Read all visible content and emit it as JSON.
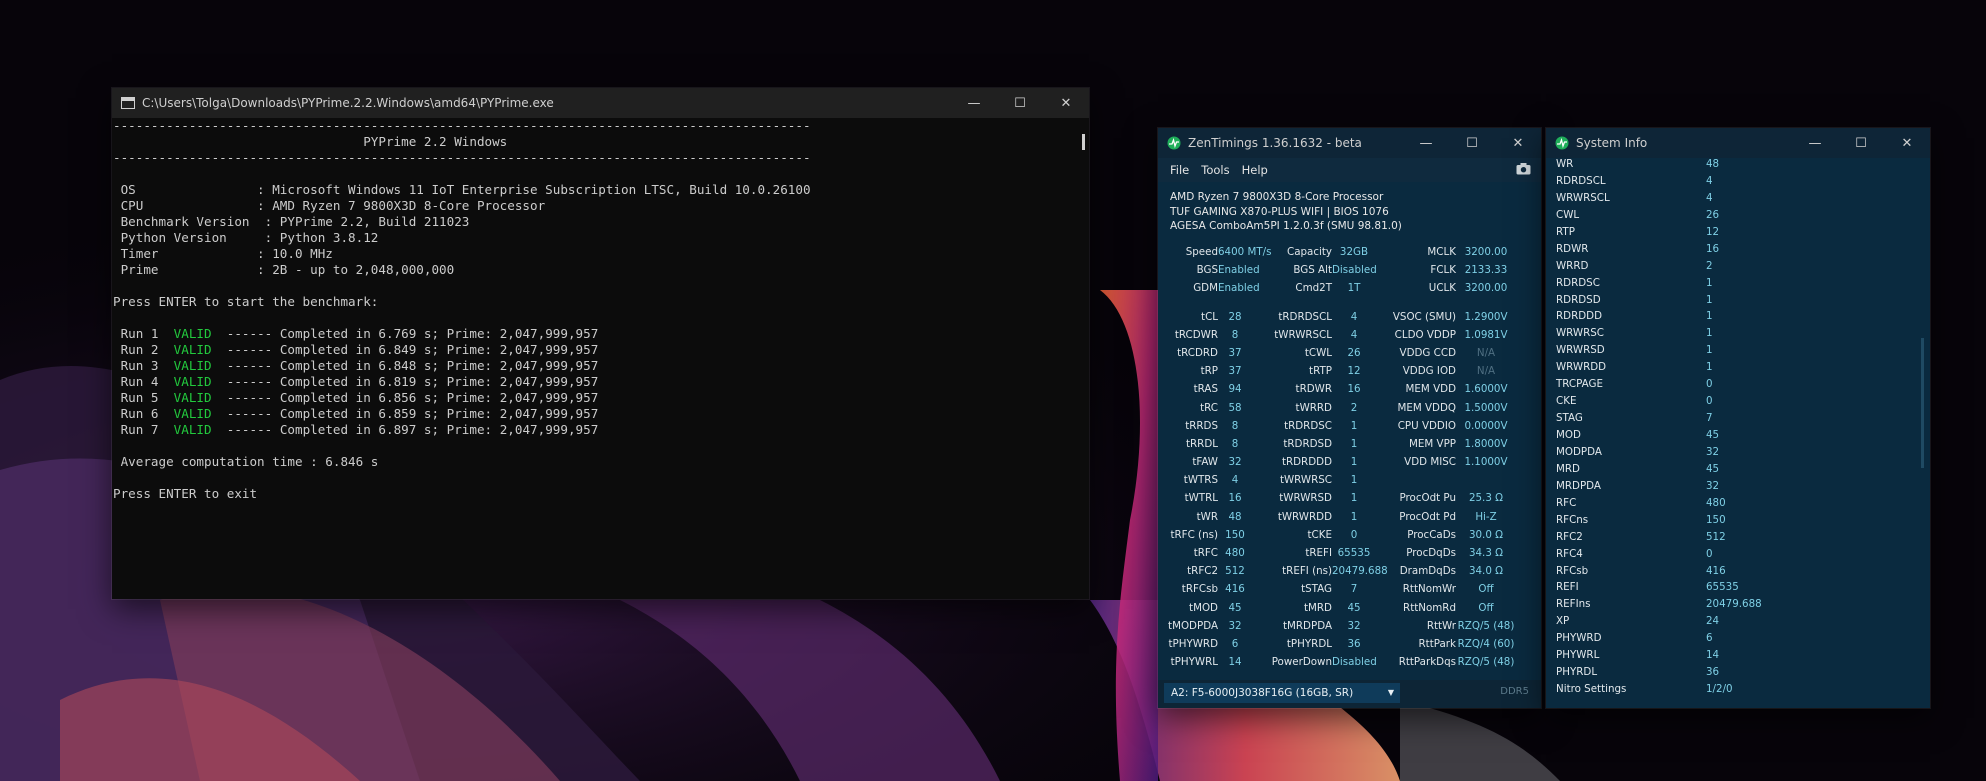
{
  "console": {
    "title": "C:\\Users\\Tolga\\Downloads\\PYPrime.2.2.Windows\\amd64\\PYPrime.exe",
    "lines": [
      {
        "text": "--------------------------------------------------------------------------------------------"
      },
      {
        "text": "                                 PYPrime 2.2 Windows"
      },
      {
        "text": "--------------------------------------------------------------------------------------------"
      },
      {
        "text": ""
      },
      {
        "text": " OS                : Microsoft Windows 11 IoT Enterprise Subscription LTSC, Build 10.0.26100"
      },
      {
        "text": " CPU               : AMD Ryzen 7 9800X3D 8-Core Processor"
      },
      {
        "text": " Benchmark Version  : PYPrime 2.2, Build 211023"
      },
      {
        "text": " Python Version     : Python 3.8.12"
      },
      {
        "text": " Timer             : 10.0 MHz"
      },
      {
        "text": " Prime             : 2B - up to 2,048,000,000"
      },
      {
        "text": ""
      },
      {
        "text": "Press ENTER to start the benchmark:"
      },
      {
        "text": ""
      }
    ],
    "runs": [
      {
        "label": " Run 1  ",
        "status": "VALID",
        "rest": "  ------ Completed in 6.769 s; Prime: 2,047,999,957"
      },
      {
        "label": " Run 2  ",
        "status": "VALID",
        "rest": "  ------ Completed in 6.849 s; Prime: 2,047,999,957"
      },
      {
        "label": " Run 3  ",
        "status": "VALID",
        "rest": "  ------ Completed in 6.848 s; Prime: 2,047,999,957"
      },
      {
        "label": " Run 4  ",
        "status": "VALID",
        "rest": "  ------ Completed in 6.819 s; Prime: 2,047,999,957"
      },
      {
        "label": " Run 5  ",
        "status": "VALID",
        "rest": "  ------ Completed in 6.856 s; Prime: 2,047,999,957"
      },
      {
        "label": " Run 6  ",
        "status": "VALID",
        "rest": "  ------ Completed in 6.859 s; Prime: 2,047,999,957"
      },
      {
        "label": " Run 7  ",
        "status": "VALID",
        "rest": "  ------ Completed in 6.897 s; Prime: 2,047,999,957"
      }
    ],
    "tail_lines": [
      {
        "text": ""
      },
      {
        "text": " Average computation time : 6.846 s"
      },
      {
        "text": ""
      },
      {
        "text": "Press ENTER to exit"
      }
    ]
  },
  "zen": {
    "title": "ZenTimings 1.36.1632 - beta",
    "menu": [
      "File",
      "Tools",
      "Help"
    ],
    "info": [
      "AMD Ryzen 7 9800X3D 8-Core Processor",
      "TUF GAMING X870-PLUS WIFI | BIOS 1076",
      "AGESA ComboAm5PI 1.2.0.3f (SMU 98.81.0)"
    ],
    "top_rows": [
      [
        [
          "Speed",
          "6400 MT/s"
        ],
        [
          "Capacity",
          "32GB"
        ],
        [
          "MCLK",
          "3200.00"
        ]
      ],
      [
        [
          "BGS",
          "Enabled"
        ],
        [
          "BGS Alt",
          "Disabled"
        ],
        [
          "FCLK",
          "2133.33"
        ]
      ],
      [
        [
          "GDM",
          "Enabled"
        ],
        [
          "Cmd2T",
          "1T"
        ],
        [
          "UCLK",
          "3200.00"
        ]
      ]
    ],
    "rows": [
      [
        [
          "tCL",
          "28"
        ],
        [
          "tRDRDSCL",
          "4"
        ],
        [
          "VSOC (SMU)",
          "1.2900V"
        ]
      ],
      [
        [
          "tRCDWR",
          "8"
        ],
        [
          "tWRWRSCL",
          "4"
        ],
        [
          "CLDO VDDP",
          "1.0981V"
        ]
      ],
      [
        [
          "tRCDRD",
          "37"
        ],
        [
          "tCWL",
          "26"
        ],
        [
          "VDDG CCD",
          "N/A"
        ]
      ],
      [
        [
          "tRP",
          "37"
        ],
        [
          "tRTP",
          "12"
        ],
        [
          "VDDG IOD",
          "N/A"
        ]
      ],
      [
        [
          "tRAS",
          "94"
        ],
        [
          "tRDWR",
          "16"
        ],
        [
          "MEM VDD",
          "1.6000V"
        ]
      ],
      [
        [
          "tRC",
          "58"
        ],
        [
          "tWRRD",
          "2"
        ],
        [
          "MEM VDDQ",
          "1.5000V"
        ]
      ],
      [
        [
          "tRRDS",
          "8"
        ],
        [
          "tRDRDSC",
          "1"
        ],
        [
          "CPU VDDIO",
          "0.0000V"
        ]
      ],
      [
        [
          "tRRDL",
          "8"
        ],
        [
          "tRDRDSD",
          "1"
        ],
        [
          "MEM VPP",
          "1.8000V"
        ]
      ],
      [
        [
          "tFAW",
          "32"
        ],
        [
          "tRDRDDD",
          "1"
        ],
        [
          "VDD MISC",
          "1.1000V"
        ]
      ],
      [
        [
          "tWTRS",
          "4"
        ],
        [
          "tWRWRSC",
          "1"
        ],
        [
          "",
          ""
        ]
      ],
      [
        [
          "tWTRL",
          "16"
        ],
        [
          "tWRWRSD",
          "1"
        ],
        [
          "ProcOdt Pu",
          "25.3 Ω"
        ]
      ],
      [
        [
          "tWR",
          "48"
        ],
        [
          "tWRWRDD",
          "1"
        ],
        [
          "ProcOdt Pd",
          "Hi-Z"
        ]
      ],
      [
        [
          "tRFC (ns)",
          "150"
        ],
        [
          "tCKE",
          "0"
        ],
        [
          "ProcCaDs",
          "30.0 Ω"
        ]
      ],
      [
        [
          "tRFC",
          "480"
        ],
        [
          "tREFI",
          "65535"
        ],
        [
          "ProcDqDs",
          "34.3 Ω"
        ]
      ],
      [
        [
          "tRFC2",
          "512"
        ],
        [
          "tREFI (ns)",
          "20479.688"
        ],
        [
          "DramDqDs",
          "34.0 Ω"
        ]
      ],
      [
        [
          "tRFCsb",
          "416"
        ],
        [
          "tSTAG",
          "7"
        ],
        [
          "RttNomWr",
          "Off"
        ]
      ],
      [
        [
          "tMOD",
          "45"
        ],
        [
          "tMRD",
          "45"
        ],
        [
          "RttNomRd",
          "Off"
        ]
      ],
      [
        [
          "tMODPDA",
          "32"
        ],
        [
          "tMRDPDA",
          "32"
        ],
        [
          "RttWr",
          "RZQ/5 (48)"
        ]
      ],
      [
        [
          "tPHYWRD",
          "6"
        ],
        [
          "tPHYRDL",
          "36"
        ],
        [
          "RttPark",
          "RZQ/4 (60)"
        ]
      ],
      [
        [
          "tPHYWRL",
          "14"
        ],
        [
          "PowerDown",
          "Disabled"
        ],
        [
          "RttParkDqs",
          "RZQ/5 (48)"
        ]
      ]
    ],
    "dimm_select": "A2: F5-6000J3038F16G (16GB, SR)",
    "ddr_label": "DDR5"
  },
  "sysinfo": {
    "title": "System Info",
    "items": [
      [
        "WR",
        "48"
      ],
      [
        "RDRDSCL",
        "4"
      ],
      [
        "WRWRSCL",
        "4"
      ],
      [
        "CWL",
        "26"
      ],
      [
        "RTP",
        "12"
      ],
      [
        "RDWR",
        "16"
      ],
      [
        "WRRD",
        "2"
      ],
      [
        "RDRDSC",
        "1"
      ],
      [
        "RDRDSD",
        "1"
      ],
      [
        "RDRDDD",
        "1"
      ],
      [
        "WRWRSC",
        "1"
      ],
      [
        "WRWRSD",
        "1"
      ],
      [
        "WRWRDD",
        "1"
      ],
      [
        "TRCPAGE",
        "0"
      ],
      [
        "CKE",
        "0"
      ],
      [
        "STAG",
        "7"
      ],
      [
        "MOD",
        "45"
      ],
      [
        "MODPDA",
        "32"
      ],
      [
        "MRD",
        "45"
      ],
      [
        "MRDPDA",
        "32"
      ],
      [
        "RFC",
        "480"
      ],
      [
        "RFCns",
        "150"
      ],
      [
        "RFC2",
        "512"
      ],
      [
        "RFC4",
        "0"
      ],
      [
        "RFCsb",
        "416"
      ],
      [
        "REFI",
        "65535"
      ],
      [
        "REFIns",
        "20479.688"
      ],
      [
        "XP",
        "24"
      ],
      [
        "PHYWRD",
        "6"
      ],
      [
        "PHYWRL",
        "14"
      ],
      [
        "PHYRDL",
        "36"
      ],
      [
        "Nitro Settings",
        "1/2/0"
      ]
    ]
  }
}
